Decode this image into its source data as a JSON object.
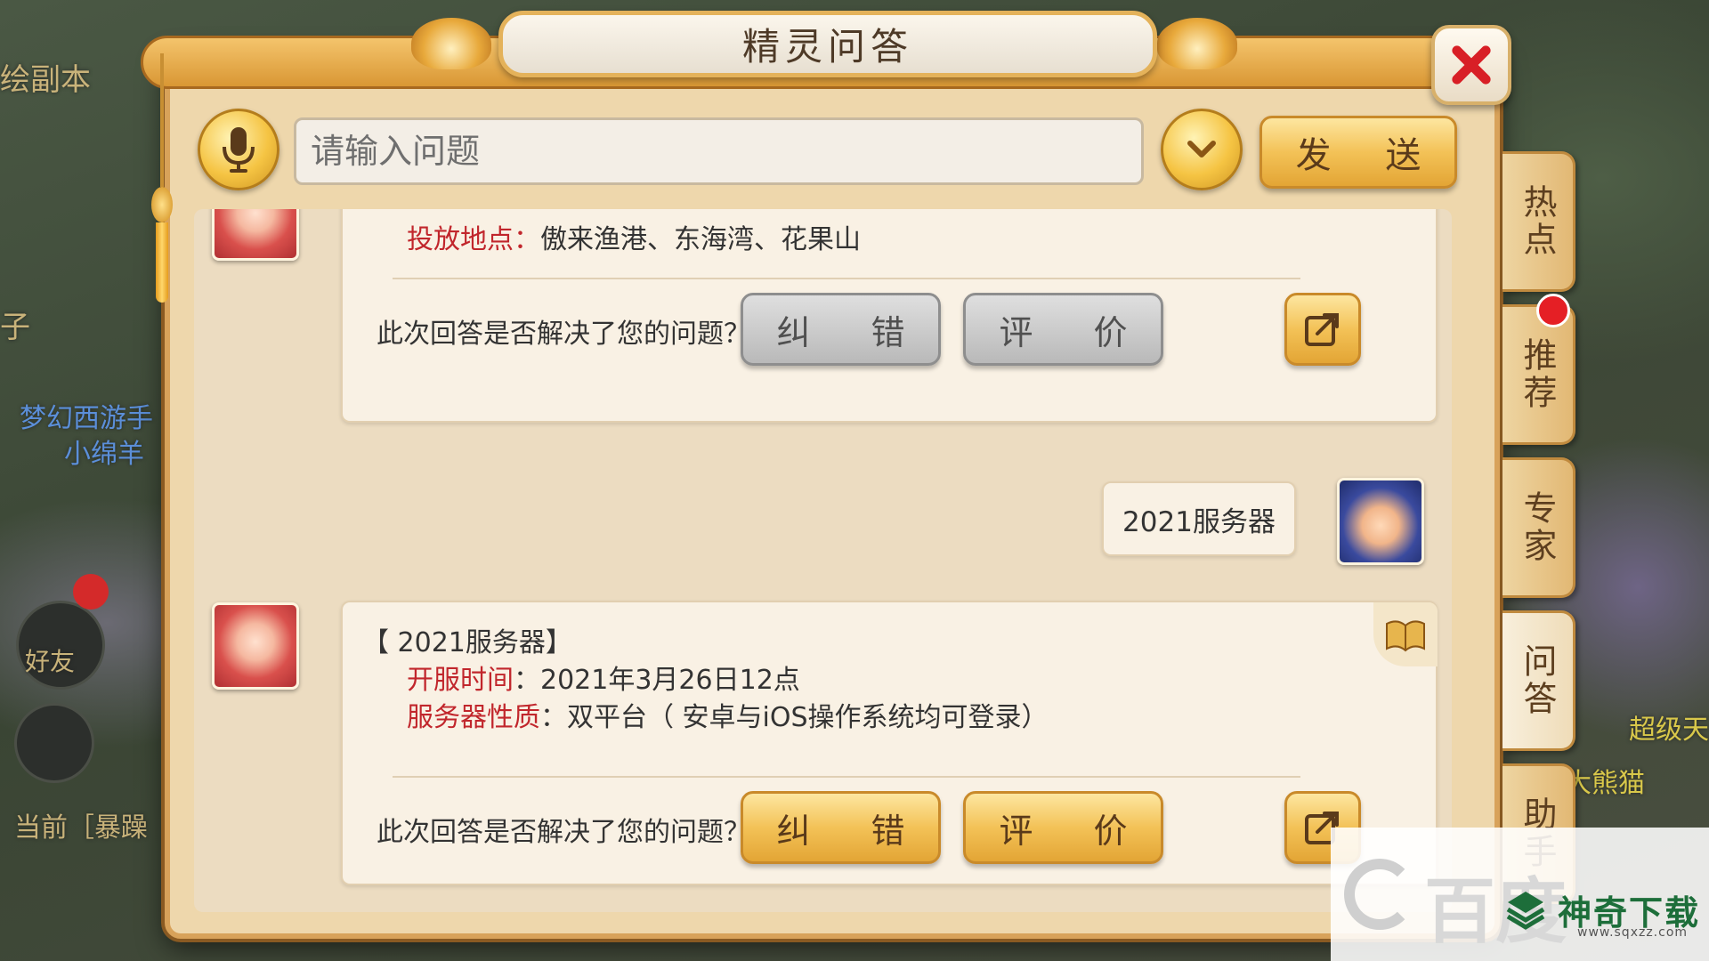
{
  "window": {
    "title": "精灵问答"
  },
  "input_bar": {
    "placeholder": "请输入问题",
    "send_label": "发 送"
  },
  "side_tabs": [
    {
      "label": "热点",
      "active": false,
      "badge": false
    },
    {
      "label": "推荐",
      "active": false,
      "badge": true
    },
    {
      "label": "专家",
      "active": false,
      "badge": false
    },
    {
      "label": "问答",
      "active": true,
      "badge": false
    },
    {
      "label": "助手",
      "active": false,
      "badge": false
    }
  ],
  "chat": {
    "answer_1": {
      "fields": [
        {
          "label": "投放地点：",
          "value": "傲来渔港、东海湾、花果山"
        }
      ],
      "feedback_question": "此次回答是否解决了您的问题？",
      "correct_label": "纠 错",
      "rate_label": "评 价",
      "state": "used"
    },
    "user_message": "2021服务器",
    "answer_2": {
      "heading": "【 2021服务器】",
      "fields": [
        {
          "label": "开服时间",
          "value": "：2021年3月26日12点"
        },
        {
          "label": "服务器性质",
          "value": "：双平台（ 安卓与iOS操作系统均可登录）"
        }
      ],
      "feedback_question": "此次回答是否解决了您的问题？",
      "correct_label": "纠 错",
      "rate_label": "评 价",
      "state": "active"
    }
  },
  "background": {
    "texts": [
      "绘副本",
      "梦幻西游手",
      "小绵羊",
      "好友",
      "当前［暴躁",
      "超级天",
      "大熊猫",
      "子"
    ]
  },
  "watermark": {
    "faint": "百度",
    "name": "神奇下载",
    "url": "www.sqxzz.com"
  },
  "colors": {
    "panel_bg": "#eed7ac",
    "gold": "#f3c257",
    "label_red": "#c1262c",
    "close_red": "#d81f26"
  }
}
